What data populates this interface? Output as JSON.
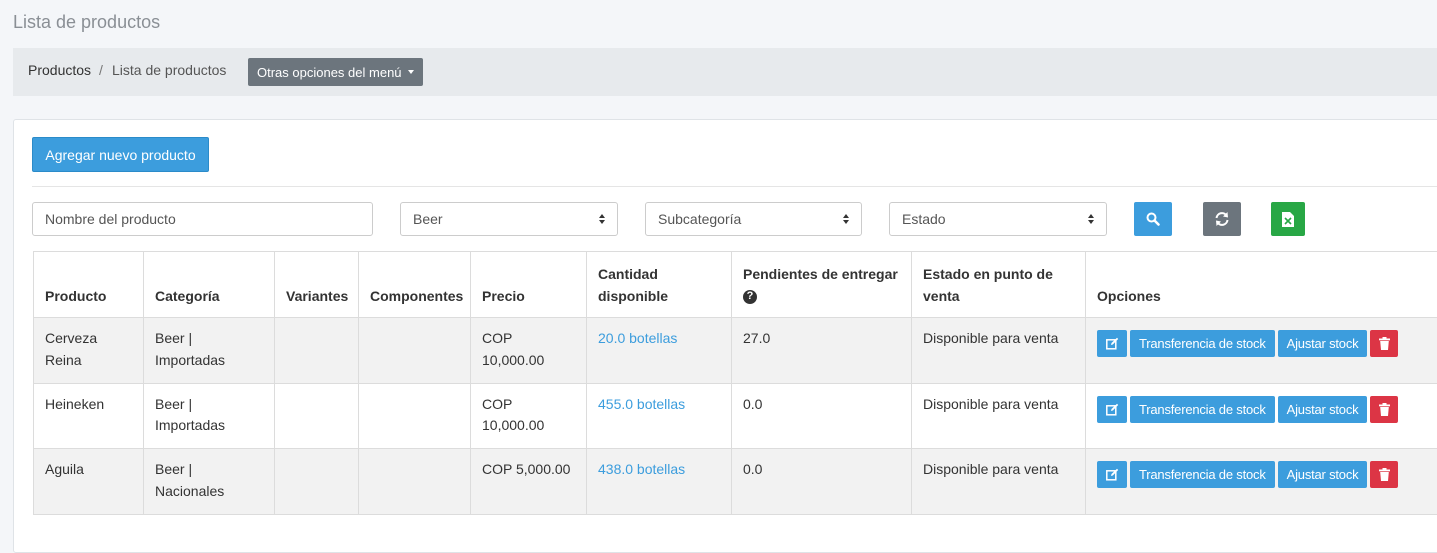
{
  "page_title": "Lista de productos",
  "breadcrumb": {
    "root": "Productos",
    "separator": "/",
    "current": "Lista de productos"
  },
  "menu_button": {
    "label": "Otras opciones del menú"
  },
  "add_button": {
    "label": "Agregar nuevo producto"
  },
  "filters": {
    "name_placeholder": "Nombre del producto",
    "category_selected": "Beer",
    "subcategory_selected": "Subcategoría",
    "status_selected": "Estado"
  },
  "table": {
    "headers": {
      "product": "Producto",
      "category": "Categoría",
      "variants": "Variantes",
      "components": "Componentes",
      "price": "Precio",
      "quantity": "Cantidad disponible",
      "pending": "Pendientes de entregar",
      "pos_status": "Estado en punto de venta",
      "options": "Opciones"
    },
    "help_glyph": "?",
    "rows": [
      {
        "product": "Cerveza Reina",
        "category": "Beer | Importadas",
        "variants": "",
        "components": "",
        "price": "COP 10,000.00",
        "quantity": "20.0 botellas",
        "pending": "27.0",
        "pos_status": "Disponible para venta"
      },
      {
        "product": "Heineken",
        "category": "Beer | Importadas",
        "variants": "",
        "components": "",
        "price": "COP 10,000.00",
        "quantity": "455.0 botellas",
        "pending": "0.0",
        "pos_status": "Disponible para venta"
      },
      {
        "product": "Aguila",
        "category": "Beer | Nacionales",
        "variants": "",
        "components": "",
        "price": "COP 5,000.00",
        "quantity": "438.0 botellas",
        "pending": "0.0",
        "pos_status": "Disponible para venta"
      }
    ],
    "row_actions": {
      "transfer": "Transferencia de stock",
      "adjust": "Ajustar stock"
    }
  },
  "icons": {
    "edit": "edit-icon",
    "delete": "trash-icon",
    "search": "search-icon",
    "refresh": "refresh-icon",
    "export": "excel-icon",
    "help": "question-circle-icon"
  },
  "colors": {
    "primary": "#3c9ddd",
    "secondary": "#6c757d",
    "success": "#28a745",
    "danger": "#dc3545"
  }
}
